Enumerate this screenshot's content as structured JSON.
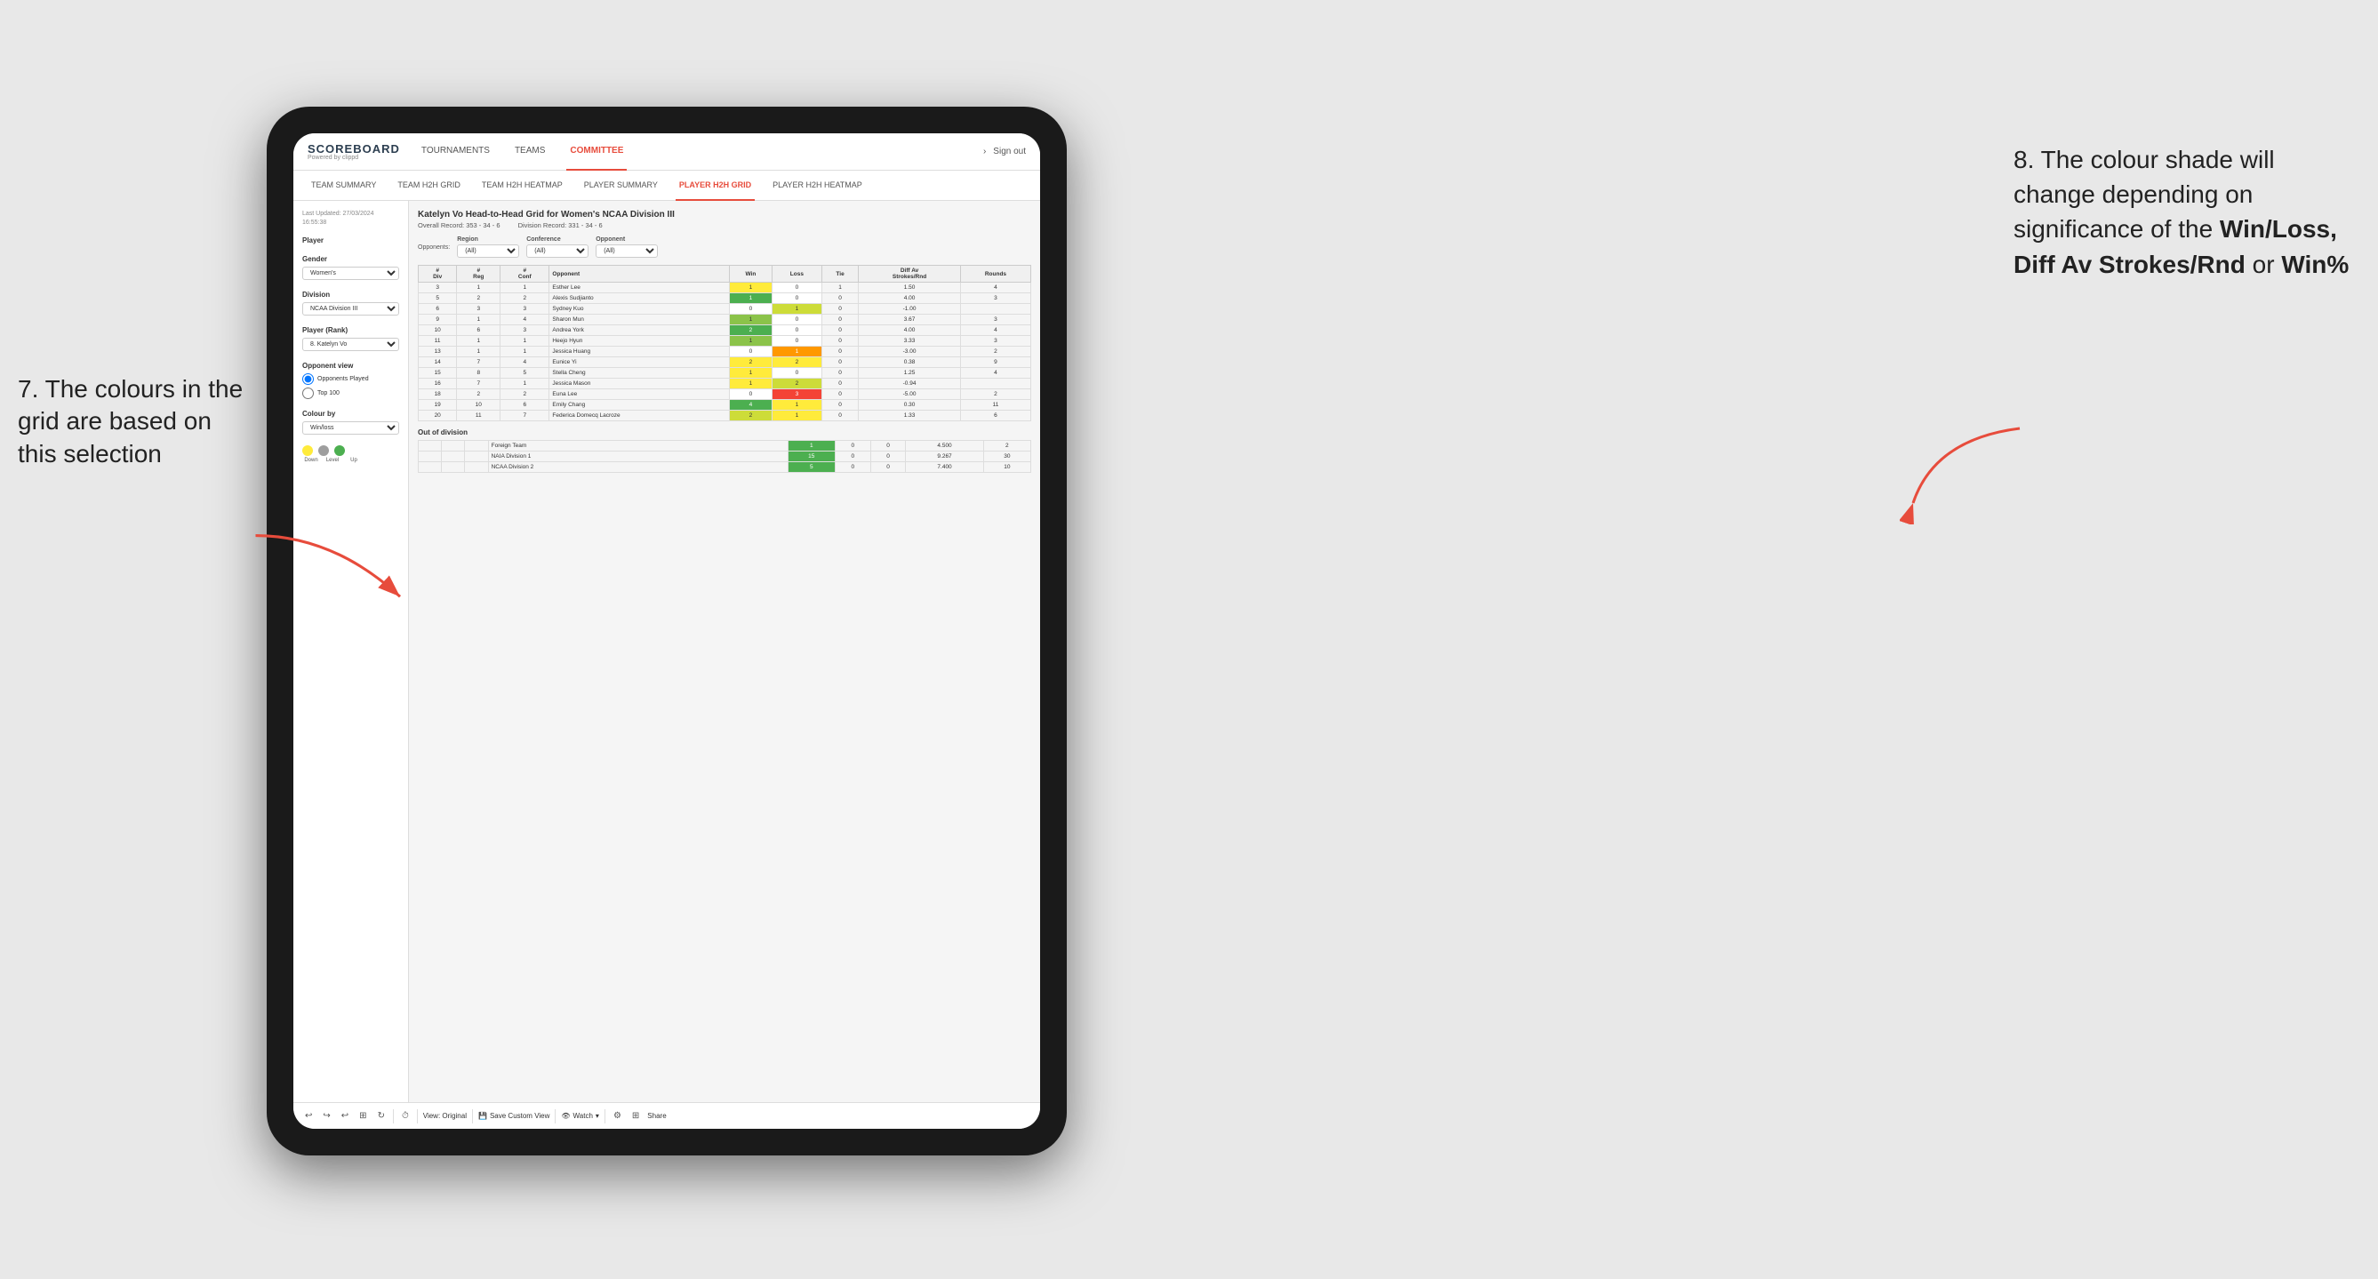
{
  "annotations": {
    "left_title": "7. The colours in the grid are based on this selection",
    "right_title": "8. The colour shade will change depending on significance of the",
    "right_bold1": "Win/Loss,",
    "right_bold2": "Diff Av Strokes/Rnd",
    "right_bold3": "or",
    "right_bold4": "Win%"
  },
  "nav": {
    "logo_main": "SCOREBOARD",
    "logo_sub": "Powered by clippd",
    "items": [
      "TOURNAMENTS",
      "TEAMS",
      "COMMITTEE"
    ],
    "active": "COMMITTEE",
    "sign_in": "Sign out"
  },
  "sub_nav": {
    "items": [
      "TEAM SUMMARY",
      "TEAM H2H GRID",
      "TEAM H2H HEATMAP",
      "PLAYER SUMMARY",
      "PLAYER H2H GRID",
      "PLAYER H2H HEATMAP"
    ],
    "active": "PLAYER H2H GRID"
  },
  "sidebar": {
    "timestamp": "Last Updated: 27/03/2024\n16:55:38",
    "player_section": "Player",
    "gender_label": "Gender",
    "gender_value": "Women's",
    "division_label": "Division",
    "division_value": "NCAA Division III",
    "player_rank_label": "Player (Rank)",
    "player_rank_value": "8. Katelyn Vo",
    "opponent_view_label": "Opponent view",
    "opponents_played": "Opponents Played",
    "top_100": "Top 100",
    "colour_by_label": "Colour by",
    "colour_by_value": "Win/loss",
    "legend_down": "Down",
    "legend_level": "Level",
    "legend_up": "Up"
  },
  "report": {
    "title": "Katelyn Vo Head-to-Head Grid for Women's NCAA Division III",
    "overall_record_label": "Overall Record:",
    "overall_record_value": "353 - 34 - 6",
    "division_record_label": "Division Record:",
    "division_record_value": "331 - 34 - 6"
  },
  "filters": {
    "region_label": "Region",
    "region_value": "(All)",
    "conference_label": "Conference",
    "conference_value": "(All)",
    "opponent_label": "Opponent",
    "opponent_value": "(All)",
    "opponents_label": "Opponents:"
  },
  "table_headers": {
    "div": "#\nDiv",
    "reg": "#\nReg",
    "conf": "#\nConf",
    "opponent": "Opponent",
    "win": "Win",
    "loss": "Loss",
    "tie": "Tie",
    "diff": "Diff Av\nStrokes/Rnd",
    "rounds": "Rounds"
  },
  "table_rows": [
    {
      "div": "3",
      "reg": "1",
      "conf": "1",
      "name": "Esther Lee",
      "win": 1,
      "loss": 0,
      "tie": 1,
      "diff": "1.50",
      "rounds": "4",
      "win_color": "yellow",
      "loss_color": "white",
      "tie_color": "white"
    },
    {
      "div": "5",
      "reg": "2",
      "conf": "2",
      "name": "Alexis Sudjianto",
      "win": 1,
      "loss": 0,
      "tie": 0,
      "diff": "4.00",
      "rounds": "3",
      "win_color": "green-dark",
      "loss_color": "white",
      "tie_color": "white"
    },
    {
      "div": "6",
      "reg": "3",
      "conf": "3",
      "name": "Sydney Kuo",
      "win": 0,
      "loss": 1,
      "tie": 0,
      "diff": "-1.00",
      "rounds": "",
      "win_color": "white",
      "loss_color": "green-light",
      "tie_color": "white"
    },
    {
      "div": "9",
      "reg": "1",
      "conf": "4",
      "name": "Sharon Mun",
      "win": 1,
      "loss": 0,
      "tie": 0,
      "diff": "3.67",
      "rounds": "3",
      "win_color": "green-med",
      "loss_color": "white",
      "tie_color": "white"
    },
    {
      "div": "10",
      "reg": "6",
      "conf": "3",
      "name": "Andrea York",
      "win": 2,
      "loss": 0,
      "tie": 0,
      "diff": "4.00",
      "rounds": "4",
      "win_color": "green-dark",
      "loss_color": "white",
      "tie_color": "white"
    },
    {
      "div": "11",
      "reg": "1",
      "conf": "1",
      "name": "Heejo Hyun",
      "win": 1,
      "loss": 0,
      "tie": 0,
      "diff": "3.33",
      "rounds": "3",
      "win_color": "green-med",
      "loss_color": "white",
      "tie_color": "white"
    },
    {
      "div": "13",
      "reg": "1",
      "conf": "1",
      "name": "Jessica Huang",
      "win": 0,
      "loss": 1,
      "tie": 0,
      "diff": "-3.00",
      "rounds": "2",
      "win_color": "white",
      "loss_color": "orange",
      "tie_color": "white"
    },
    {
      "div": "14",
      "reg": "7",
      "conf": "4",
      "name": "Eunice Yi",
      "win": 2,
      "loss": 2,
      "tie": 0,
      "diff": "0.38",
      "rounds": "9",
      "win_color": "yellow",
      "loss_color": "yellow",
      "tie_color": "white"
    },
    {
      "div": "15",
      "reg": "8",
      "conf": "5",
      "name": "Stella Cheng",
      "win": 1,
      "loss": 0,
      "tie": 0,
      "diff": "1.25",
      "rounds": "4",
      "win_color": "yellow",
      "loss_color": "white",
      "tie_color": "white"
    },
    {
      "div": "16",
      "reg": "7",
      "conf": "1",
      "name": "Jessica Mason",
      "win": 1,
      "loss": 2,
      "tie": 0,
      "diff": "-0.94",
      "rounds": "",
      "win_color": "yellow",
      "loss_color": "green-light",
      "tie_color": "white"
    },
    {
      "div": "18",
      "reg": "2",
      "conf": "2",
      "name": "Euna Lee",
      "win": 0,
      "loss": 3,
      "tie": 0,
      "diff": "-5.00",
      "rounds": "2",
      "win_color": "white",
      "loss_color": "red",
      "tie_color": "white"
    },
    {
      "div": "19",
      "reg": "10",
      "conf": "6",
      "name": "Emily Chang",
      "win": 4,
      "loss": 1,
      "tie": 0,
      "diff": "0.30",
      "rounds": "11",
      "win_color": "green-dark",
      "loss_color": "yellow",
      "tie_color": "white"
    },
    {
      "div": "20",
      "reg": "11",
      "conf": "7",
      "name": "Federica Domecq Lacroze",
      "win": 2,
      "loss": 1,
      "tie": 0,
      "diff": "1.33",
      "rounds": "6",
      "win_color": "green-light",
      "loss_color": "yellow",
      "tie_color": "white"
    }
  ],
  "out_of_division": {
    "header": "Out of division",
    "rows": [
      {
        "name": "Foreign Team",
        "win": 1,
        "loss": 0,
        "tie": 0,
        "diff": "4.500",
        "rounds": "2",
        "win_color": "green-dark",
        "loss_color": "white",
        "tie_color": "white"
      },
      {
        "name": "NAIA Division 1",
        "win": 15,
        "loss": 0,
        "tie": 0,
        "diff": "9.267",
        "rounds": "30",
        "win_color": "green-dark",
        "loss_color": "white",
        "tie_color": "white"
      },
      {
        "name": "NCAA Division 2",
        "win": 5,
        "loss": 0,
        "tie": 0,
        "diff": "7.400",
        "rounds": "10",
        "win_color": "green-dark",
        "loss_color": "white",
        "tie_color": "white"
      }
    ]
  },
  "toolbar": {
    "view_original": "View: Original",
    "save_custom": "Save Custom View",
    "watch": "Watch",
    "share": "Share"
  }
}
